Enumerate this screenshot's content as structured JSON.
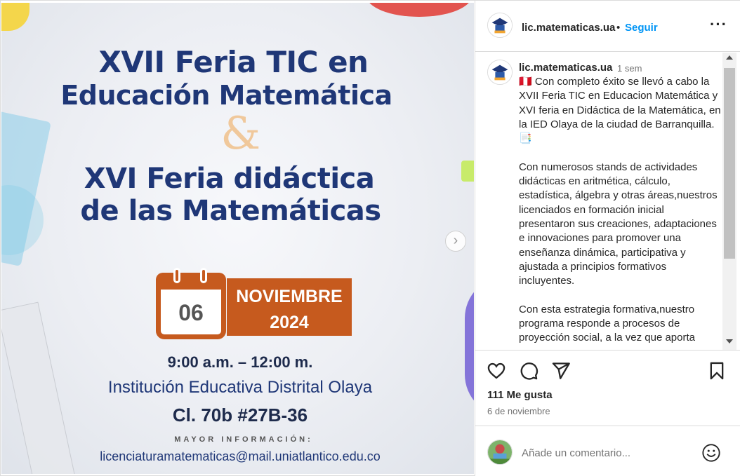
{
  "poster": {
    "title_line1": "XVII Feria TIC en",
    "title_line2": "Educación Matemática",
    "ampersand": "&",
    "title_line3": "XVI Feria didáctica",
    "title_line4": "de las Matemáticas",
    "day": "06",
    "month": "NOVIEMBRE",
    "year": "2024",
    "time": "9:00 a.m. – 12:00 m.",
    "institution": "Institución Educativa Distrital Olaya",
    "address": "Cl. 70b #27B-36",
    "more_info": "MAYOR INFORMACIÓN:",
    "email": "licenciaturamatematicas@mail.uniatlantico.edu.co"
  },
  "header": {
    "username": "lic.matematicas.ua",
    "dot": "•",
    "follow_label": "Seguir",
    "more_label": "···"
  },
  "caption": {
    "username": "lic.matematicas.ua",
    "time": "1 sem",
    "body": "🇵🇪 Con completo éxito se llevó a cabo la XVII Feria TIC en Educacion Matemática y XVI feria en Didáctica de la Matemática, en la IED Olaya de la ciudad de Barranquilla.📑\n\nCon numerosos stands de actividades didácticas en aritmética, cálculo, estadística, álgebra y otras áreas,nuestros licenciados en formación inicial presentaron sus creaciones, adaptaciones e innovaciones para promover una enseñanza dinámica, participativa y ajustada a principios formativos incluyentes.\n\nCon esta estrategia formativa,nuestro programa responde a procesos de proyección social, a la vez que aporta"
  },
  "stats": {
    "likes": "111 Me gusta",
    "date": "6 de noviembre"
  },
  "comment_box": {
    "placeholder": "Añade un comentario..."
  },
  "icons": {
    "like": "heart-icon",
    "comment": "comment-bubble-icon",
    "share": "paper-plane-icon",
    "save": "bookmark-icon",
    "emoji": "smiley-icon",
    "next": "chevron-right-icon"
  },
  "colors": {
    "follow_blue": "#0095f6",
    "poster_navy": "#1f3777",
    "poster_orange": "#c65a1e"
  }
}
